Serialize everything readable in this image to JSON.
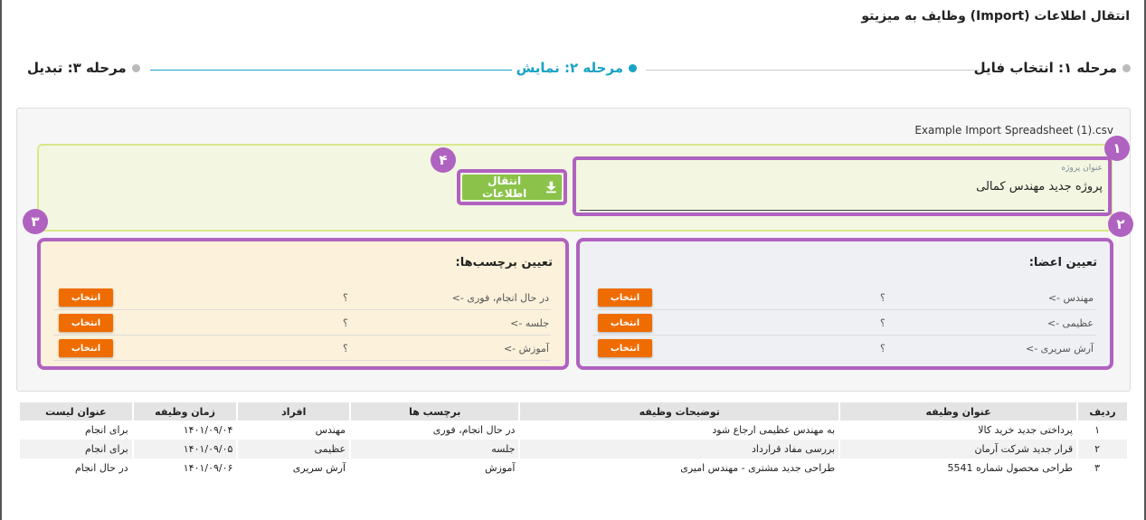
{
  "page": {
    "title": "انتقال اطلاعات (Import) وظایف به میزیتو"
  },
  "steps": [
    {
      "label": "مرحله ۱: انتخاب فایل",
      "active": false
    },
    {
      "label": "مرحله ۲: نمایش",
      "active": true
    },
    {
      "label": "مرحله ۳: تبدیل",
      "active": false
    }
  ],
  "file": {
    "name": "Example Import Spreadsheet (1).csv"
  },
  "project": {
    "label": "عنوان پروژه",
    "value": "پروژه جدید مهندس کمالی"
  },
  "import_button": {
    "label": "انتقال اطلاعات"
  },
  "badges": [
    "۱",
    "۲",
    "۳",
    "۴"
  ],
  "members": {
    "title": "تعیین اعضا:",
    "rows": [
      {
        "name": "مهندس ->",
        "value": "؟",
        "button": "انتخاب"
      },
      {
        "name": "عظیمی ->",
        "value": "؟",
        "button": "انتخاب"
      },
      {
        "name": "آرش سریری ->",
        "value": "؟",
        "button": "انتخاب"
      }
    ]
  },
  "tags": {
    "title": "تعیین برچسب‌ها:",
    "rows": [
      {
        "name": "در حال انجام، فوری ->",
        "value": "؟",
        "button": "انتخاب"
      },
      {
        "name": "جلسه ->",
        "value": "؟",
        "button": "انتخاب"
      },
      {
        "name": "آموزش ->",
        "value": "؟",
        "button": "انتخاب"
      }
    ]
  },
  "table": {
    "headers": [
      "ردیف",
      "عنوان وظیفه",
      "توضیحات وظیفه",
      "برچسب ها",
      "افراد",
      "زمان وظیفه",
      "عنوان لیست"
    ],
    "rows": [
      [
        "۱",
        "پرداختی جدید خرید کالا",
        "به مهندس عظیمی ارجاع شود",
        "در حال انجام، فوری",
        "مهندس",
        "۱۴۰۱/۰۹/۰۴",
        "برای انجام"
      ],
      [
        "۲",
        "قرار جدید شرکت آرمان",
        "بررسی مفاد قرارداد",
        "جلسه",
        "عظیمی",
        "۱۴۰۱/۰۹/۰۵",
        "برای انجام"
      ],
      [
        "۳",
        "طراحی محصول شماره 5541",
        "طراحی جدید مشتری - مهندس امیری",
        "آموزش",
        "آرش سریری",
        "۱۴۰۱/۰۹/۰۶",
        "در حال انجام"
      ]
    ]
  },
  "colors": {
    "accent": "#19a3c4",
    "badge": "#b062c0",
    "import": "#8bc34a",
    "select": "#ef6c00"
  }
}
